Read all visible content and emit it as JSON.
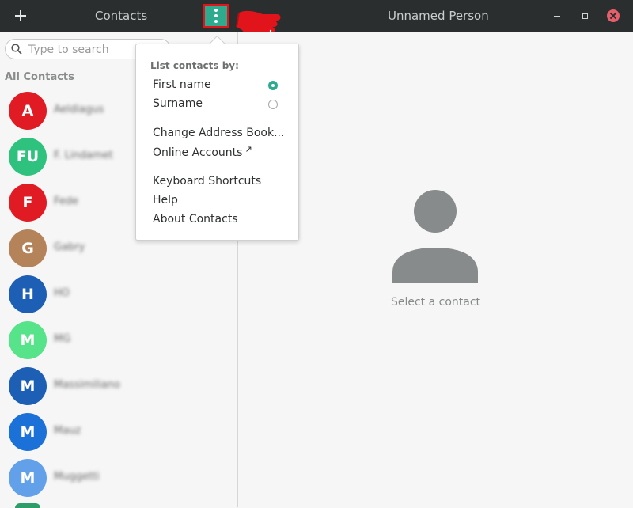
{
  "header": {
    "sidebar_title": "Contacts",
    "person_title": "Unnamed Person",
    "add_icon": "plus-icon",
    "menu_icon": "vertical-dots-icon",
    "accent": "#2eab8e"
  },
  "sidebar": {
    "search_placeholder": "Type to search",
    "section_label": "All Contacts",
    "contacts": [
      {
        "initials": "A",
        "name": "Aeldiagus",
        "color": "#e01b24"
      },
      {
        "initials": "FU",
        "name": "F. Lindamet",
        "color": "#2ec27e"
      },
      {
        "initials": "F",
        "name": "Fede",
        "color": "#e01b24"
      },
      {
        "initials": "G",
        "name": "Gabry",
        "color": "#b5835a"
      },
      {
        "initials": "H",
        "name": "HO",
        "color": "#1c5fb5"
      },
      {
        "initials": "M",
        "name": "MG",
        "color": "#57e389"
      },
      {
        "initials": "M",
        "name": "Massimiliano",
        "color": "#1c5fb5"
      },
      {
        "initials": "M",
        "name": "Mauz",
        "color": "#1c71d8"
      },
      {
        "initials": "M",
        "name": "Muggetti",
        "color": "#62a0ea"
      }
    ]
  },
  "popover": {
    "heading": "List contacts by:",
    "sort_options": [
      {
        "label": "First name",
        "selected": true
      },
      {
        "label": "Surname",
        "selected": false
      }
    ],
    "change_address_book": "Change Address Book...",
    "online_accounts": "Online Accounts",
    "online_accounts_icon": "↗",
    "keyboard_shortcuts": "Keyboard Shortcuts",
    "help": "Help",
    "about": "About Contacts"
  },
  "main": {
    "placeholder_icon": "person-icon",
    "select_text": "Select a contact"
  }
}
